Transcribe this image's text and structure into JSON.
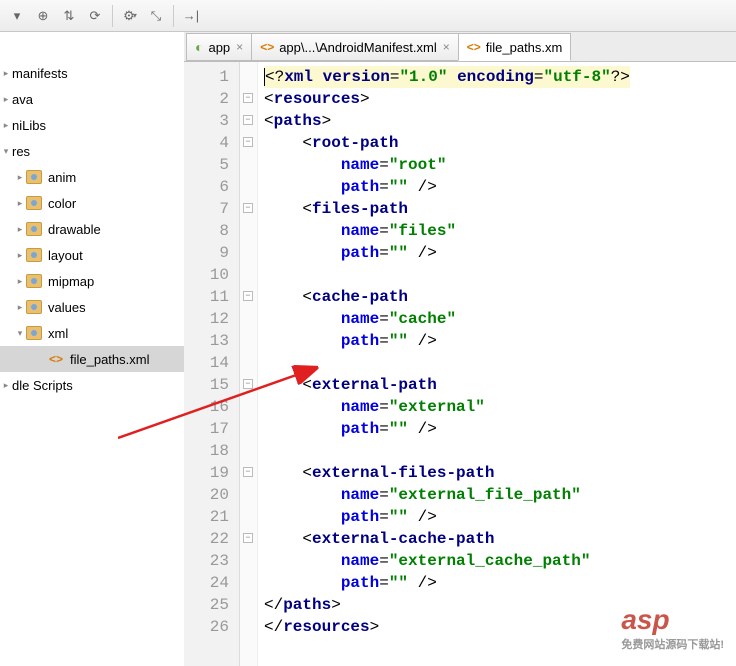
{
  "toolbar": {
    "icons": [
      "arrow-down",
      "target",
      "sync",
      "refresh",
      "gear",
      "collapse",
      "hide"
    ]
  },
  "tree": {
    "items": [
      {
        "label": "manifests",
        "level": 1,
        "arrow": "▸",
        "icon": ""
      },
      {
        "label": "ava",
        "level": 1,
        "arrow": "▸",
        "icon": ""
      },
      {
        "label": "niLibs",
        "level": 1,
        "arrow": "▸",
        "icon": ""
      },
      {
        "label": "res",
        "level": 1,
        "arrow": "▾",
        "icon": ""
      },
      {
        "label": "anim",
        "level": 2,
        "arrow": "▸",
        "icon": "folder"
      },
      {
        "label": "color",
        "level": 2,
        "arrow": "▸",
        "icon": "folder"
      },
      {
        "label": "drawable",
        "level": 2,
        "arrow": "▸",
        "icon": "folder"
      },
      {
        "label": "layout",
        "level": 2,
        "arrow": "▸",
        "icon": "folder"
      },
      {
        "label": "mipmap",
        "level": 2,
        "arrow": "▸",
        "icon": "folder"
      },
      {
        "label": "values",
        "level": 2,
        "arrow": "▸",
        "icon": "folder"
      },
      {
        "label": "xml",
        "level": 2,
        "arrow": "▾",
        "icon": "folder"
      },
      {
        "label": "file_paths.xml",
        "level": 3,
        "arrow": "",
        "icon": "xml",
        "selected": true
      },
      {
        "label": "dle Scripts",
        "level": 1,
        "arrow": "▸",
        "icon": ""
      }
    ]
  },
  "tabs": [
    {
      "label": "app",
      "icon": "app",
      "active": false
    },
    {
      "label": "app\\...\\AndroidManifest.xml",
      "icon": "xml",
      "active": false
    },
    {
      "label": "file_paths.xm",
      "icon": "xml",
      "active": true,
      "cut": true
    }
  ],
  "code": {
    "lines": [
      {
        "n": 1,
        "html": "<span class='line1bg'><span class='cursor'></span>&lt;?<span class='kw'>xml version</span>=<span class='val'>\"1.0\"</span> <span class='kw'>encoding</span>=<span class='val'>\"utf-8\"</span>?&gt;</span>"
      },
      {
        "n": 2,
        "html": "&lt;<span class='kw'>resources</span>&gt;"
      },
      {
        "n": 3,
        "html": "&lt;<span class='kw'>paths</span>&gt;"
      },
      {
        "n": 4,
        "html": "    &lt;<span class='kw'>root-path</span>"
      },
      {
        "n": 5,
        "html": "        <span class='attr'>name</span>=<span class='val'>\"root\"</span>"
      },
      {
        "n": 6,
        "html": "        <span class='attr'>path</span>=<span class='val'>\"\"</span> /&gt;"
      },
      {
        "n": 7,
        "html": "    &lt;<span class='kw'>files-path</span>"
      },
      {
        "n": 8,
        "html": "        <span class='attr'>name</span>=<span class='val'>\"files\"</span>"
      },
      {
        "n": 9,
        "html": "        <span class='attr'>path</span>=<span class='val'>\"\"</span> /&gt;"
      },
      {
        "n": 10,
        "html": ""
      },
      {
        "n": 11,
        "html": "    &lt;<span class='kw'>cache-path</span>"
      },
      {
        "n": 12,
        "html": "        <span class='attr'>name</span>=<span class='val'>\"cache\"</span>"
      },
      {
        "n": 13,
        "html": "        <span class='attr'>path</span>=<span class='val'>\"\"</span> /&gt;"
      },
      {
        "n": 14,
        "html": ""
      },
      {
        "n": 15,
        "html": "    &lt;<span class='kw'>external-path</span>"
      },
      {
        "n": 16,
        "html": "        <span class='attr'>name</span>=<span class='val'>\"external\"</span>"
      },
      {
        "n": 17,
        "html": "        <span class='attr'>path</span>=<span class='val'>\"\"</span> /&gt;"
      },
      {
        "n": 18,
        "html": ""
      },
      {
        "n": 19,
        "html": "    &lt;<span class='kw'>external-files-path</span>"
      },
      {
        "n": 20,
        "html": "        <span class='attr'>name</span>=<span class='val'>\"external_file_path\"</span>"
      },
      {
        "n": 21,
        "html": "        <span class='attr'>path</span>=<span class='val'>\"\"</span> /&gt;"
      },
      {
        "n": 22,
        "html": "    &lt;<span class='kw'>external-cache-path</span>"
      },
      {
        "n": 23,
        "html": "        <span class='attr'>name</span>=<span class='val'>\"external_cache_path\"</span>"
      },
      {
        "n": 24,
        "html": "        <span class='attr'>path</span>=<span class='val'>\"\"</span> /&gt;"
      },
      {
        "n": 25,
        "html": "&lt;/<span class='kw'>paths</span>&gt;"
      },
      {
        "n": 26,
        "html": "&lt;/<span class='kw'>resources</span>&gt;"
      }
    ],
    "fold_marks": [
      2,
      3,
      4,
      7,
      11,
      15,
      19,
      22
    ]
  },
  "watermark": {
    "main": "asp",
    "sub": "免费网站源码下载站!"
  }
}
